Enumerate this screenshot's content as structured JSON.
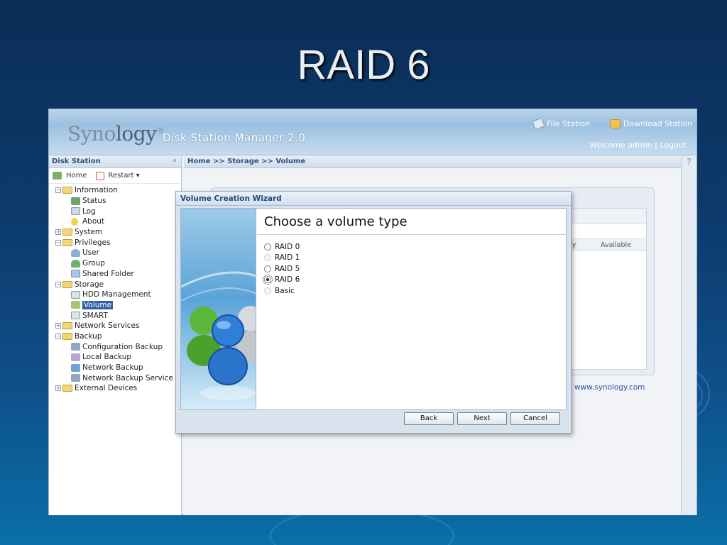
{
  "slide": {
    "title": "RAID 6"
  },
  "header": {
    "logo_syno": "Syno",
    "logo_logy": "logy",
    "logo_mark": "®",
    "product": "Disk Station Manager 2.0",
    "file_station": "File Station",
    "download_station": "Download Station",
    "welcome": "Welcome admin | Logout"
  },
  "left_panel": {
    "title": "Disk Station",
    "collapse": "«",
    "toolbar": {
      "home": "Home",
      "restart": "Restart ▾"
    },
    "tree": {
      "information": "Information",
      "status": "Status",
      "log": "Log",
      "about": "About",
      "system": "System",
      "privileges": "Privileges",
      "user": "User",
      "group": "Group",
      "shared_folder": "Shared Folder",
      "storage": "Storage",
      "hdd_management": "HDD Management",
      "volume": "Volume",
      "smart": "SMART",
      "network_services": "Network Services",
      "backup": "Backup",
      "configuration_backup": "Configuration Backup",
      "local_backup": "Local Backup",
      "network_backup": "Network Backup",
      "network_backup_service": "Network Backup Service",
      "external_devices": "External Devices"
    }
  },
  "main": {
    "breadcrumb": "Home >> Storage >> Volume",
    "help": "?",
    "col_partial": "ty",
    "col_available": "Available",
    "site_link": "www.synology.com"
  },
  "wizard": {
    "title": "Volume Creation Wizard",
    "heading": "Choose a volume type",
    "options": {
      "raid0": "RAID 0",
      "raid1": "RAID 1",
      "raid5": "RAID 5",
      "raid6": "RAID 6",
      "basic": "Basic"
    },
    "selected": "RAID 6",
    "back": "Back",
    "next": "Next",
    "cancel": "Cancel"
  },
  "colors": {
    "slide_bg": "#0d3a6c",
    "selection": "#2f5fa6",
    "link": "#2c55a5"
  }
}
